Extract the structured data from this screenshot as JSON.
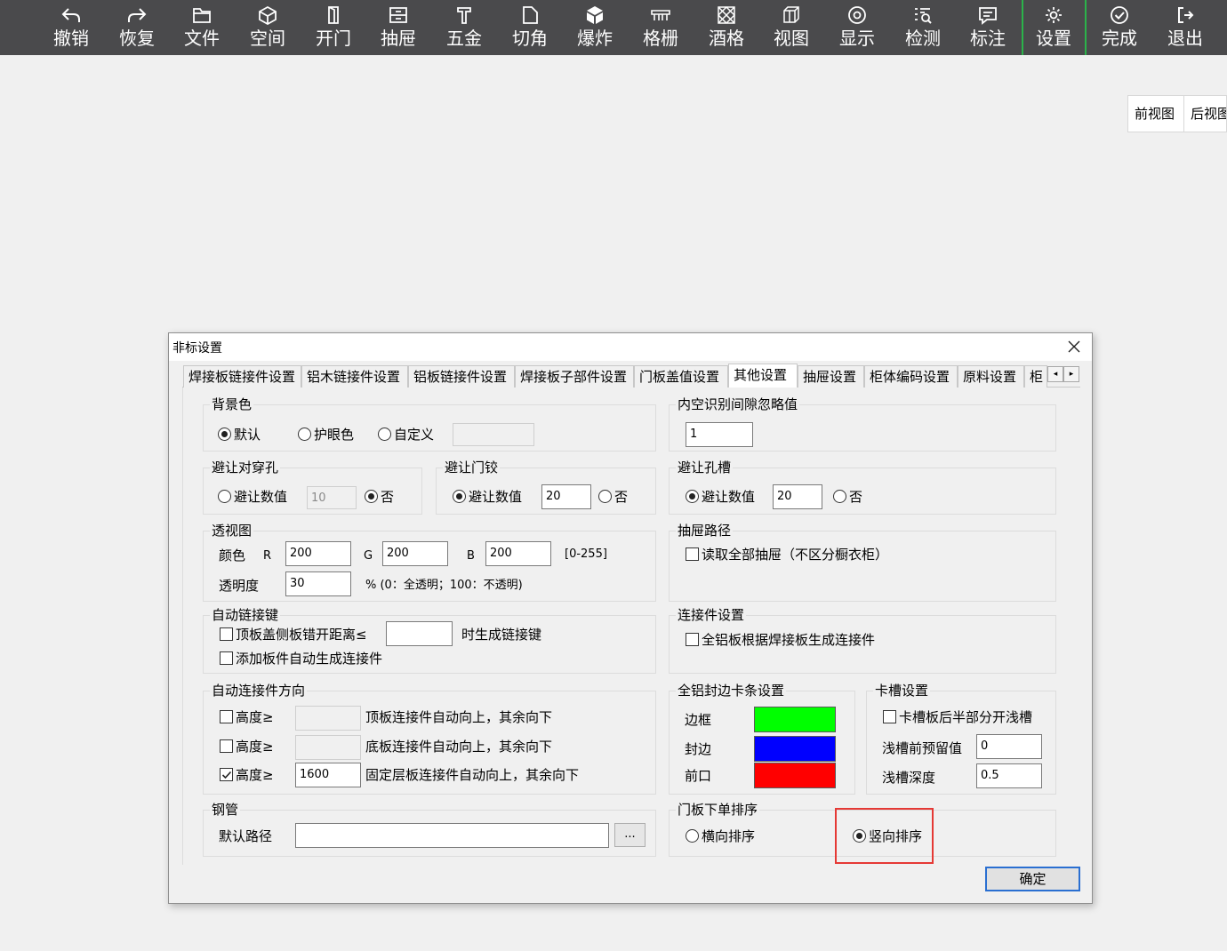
{
  "toolbar": {
    "items": [
      {
        "label": "撤销",
        "icon": "undo-icon"
      },
      {
        "label": "恢复",
        "icon": "redo-icon"
      },
      {
        "label": "文件",
        "icon": "folder-icon"
      },
      {
        "label": "空间",
        "icon": "cube-icon"
      },
      {
        "label": "开门",
        "icon": "door-icon"
      },
      {
        "label": "抽屉",
        "icon": "drawer-icon"
      },
      {
        "label": "五金",
        "icon": "hardware-icon"
      },
      {
        "label": "切角",
        "icon": "corner-cut-icon"
      },
      {
        "label": "爆炸",
        "icon": "explode-icon"
      },
      {
        "label": "格栅",
        "icon": "grille-icon"
      },
      {
        "label": "酒格",
        "icon": "wine-rack-icon"
      },
      {
        "label": "视图",
        "icon": "view-icon"
      },
      {
        "label": "显示",
        "icon": "eye-icon"
      },
      {
        "label": "检测",
        "icon": "detect-icon"
      },
      {
        "label": "标注",
        "icon": "annotation-icon"
      },
      {
        "label": "设置",
        "icon": "gear-icon"
      },
      {
        "label": "完成",
        "icon": "check-circle-icon"
      },
      {
        "label": "退出",
        "icon": "exit-icon"
      }
    ]
  },
  "views": {
    "front": "前视图",
    "back": "后视图"
  },
  "dialog": {
    "title": "非标设置",
    "tabs": [
      "焊接板链接件设置",
      "铝木链接件设置",
      "铝板链接件设置",
      "焊接板子部件设置",
      "门板盖值设置",
      "其他设置",
      "抽屉设置",
      "柜体编码设置",
      "原料设置",
      "柜"
    ],
    "active_tab": "其他设置",
    "background": {
      "title": "背景色",
      "options": [
        "默认",
        "护眼色",
        "自定义"
      ],
      "selected": "默认"
    },
    "gap_ignore": {
      "title": "内空识别间隙忽略值",
      "value": "1"
    },
    "avoid_through_hole": {
      "title": "避让对穿孔",
      "opt_value": "避让数值",
      "value": "10",
      "opt_no": "否",
      "selected": "否"
    },
    "avoid_hinge": {
      "title": "避让门铰",
      "opt_value": "避让数值",
      "value": "20",
      "opt_no": "否",
      "selected": "避让数值"
    },
    "avoid_slot": {
      "title": "避让孔槽",
      "opt_value": "避让数值",
      "value": "20",
      "opt_no": "否",
      "selected": "避让数值"
    },
    "perspective": {
      "title": "透视图",
      "color_label": "颜色",
      "r_label": "R",
      "r": "200",
      "g_label": "G",
      "g": "200",
      "b_label": "B",
      "b": "200",
      "range": "[0-255]",
      "opacity_label": "透明度",
      "opacity": "30",
      "opacity_hint": "% (0：全透明；100：不透明)"
    },
    "drawer_path": {
      "title": "抽屉路径",
      "option": "读取全部抽屉（不区分橱衣柜）",
      "checked": false
    },
    "auto_link": {
      "title": "自动链接键",
      "row1": "顶板盖侧板错开距离≤",
      "row1_value": "",
      "row1_suffix": "时生成链接键",
      "row2": "添加板件自动生成连接件"
    },
    "connector": {
      "title": "连接件设置",
      "option": "全铝板根据焊接板生成连接件"
    },
    "auto_dir": {
      "title": "自动连接件方向",
      "rows": [
        {
          "label": "高度≥",
          "value": "",
          "desc": "顶板连接件自动向上，其余向下",
          "checked": false
        },
        {
          "label": "高度≥",
          "value": "",
          "desc": "底板连接件自动向上，其余向下",
          "checked": false
        },
        {
          "label": "高度≥",
          "value": "1600",
          "desc": "固定层板连接件自动向上，其余向下",
          "checked": true
        }
      ]
    },
    "edge_strip": {
      "title": "全铝封边卡条设置",
      "frame": "边框",
      "frame_color": "#00ff00",
      "seal": "封边",
      "seal_color": "#0000ff",
      "front": "前口",
      "front_color": "#ff0000"
    },
    "slot": {
      "title": "卡槽设置",
      "option": "卡槽板后半部分开浅槽",
      "reserve_label": "浅槽前预留值",
      "reserve": "0",
      "depth_label": "浅槽深度",
      "depth": "0.5"
    },
    "pipe": {
      "title": "钢管",
      "path_label": "默认路径",
      "path": "",
      "browse": "..."
    },
    "door_sort": {
      "title": "门板下单排序",
      "opt_h": "横向排序",
      "opt_v": "竖向排序",
      "selected": "竖向排序"
    },
    "ok": "确定"
  }
}
